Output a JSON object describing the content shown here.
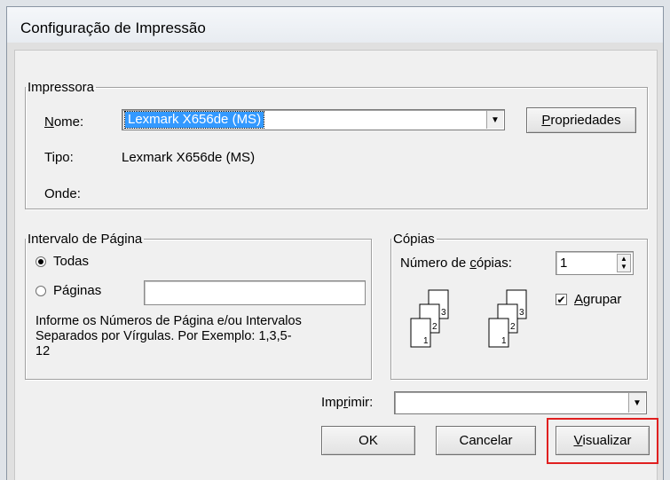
{
  "window": {
    "title": "Configuração de Impressão"
  },
  "printer": {
    "legend": "Impressora",
    "name_label": "Nome:",
    "name_value": "Lexmark X656de (MS)",
    "properties_button": "Propriedades",
    "type_label": "Tipo:",
    "type_value": "Lexmark X656de (MS)",
    "where_label": "Onde:"
  },
  "range": {
    "legend": "Intervalo de Página",
    "all_label": "Todas",
    "pages_label": "Páginas",
    "pages_value": "",
    "hint": "Informe os Números de Página e/ou Intervalos Separados por Vírgulas. Por Exemplo: 1,3,5-12",
    "selected": "all"
  },
  "copies": {
    "legend": "Cópias",
    "count_label": "Número de cópias:",
    "count_value": "1",
    "collate_label": "Agrupar",
    "collate_checked": true,
    "collated_icon_pages": [
      "3",
      "2",
      "1"
    ],
    "uncollated_icon_pages": [
      "3",
      "2",
      "1"
    ]
  },
  "print": {
    "label": "Imprimir:",
    "value": ""
  },
  "buttons": {
    "ok": "OK",
    "cancel": "Cancelar",
    "preview": "Visualizar"
  },
  "colors": {
    "selection": "#3399ff",
    "highlight": "#e02020"
  }
}
